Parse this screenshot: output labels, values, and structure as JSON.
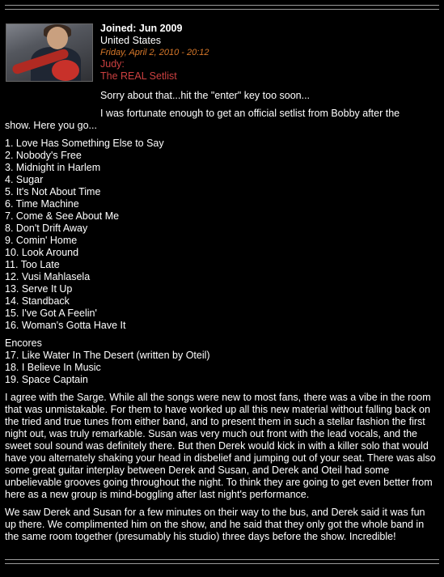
{
  "user": {
    "joined": "Joined: Jun 2009",
    "location": "United States",
    "avatar_icon": "user-avatar-photo"
  },
  "post": {
    "date": "Friday, April 2, 2010 - 20:12",
    "author": "Judy",
    "subject": "The REAL Setlist",
    "sorry": "Sorry about that...hit the \"enter\" key too soon...",
    "intro_line1": "I was fortunate enough to get an official setlist from Bobby after the",
    "intro_line2": "show. Here you go...",
    "setlist": [
      "1. Love Has Something Else to Say",
      "2. Nobody's Free",
      "3. Midnight in Harlem",
      "4. Sugar",
      "5. It's Not About Time",
      "6. Time Machine",
      "7. Come & See About Me",
      "8. Don't Drift Away",
      "9. Comin' Home",
      "10. Look Around",
      "11. Too Late",
      "12. Vusi Mahlasela",
      "13. Serve It Up",
      "14. Standback",
      "15. I've Got A Feelin'",
      "16. Woman's Gotta Have It"
    ],
    "encores_label": "Encores",
    "encores": [
      "17. Like Water In The Desert (written by Oteil)",
      "18. I Believe In Music",
      "19. Space Captain"
    ],
    "paragraph1": "I agree with the Sarge. While all the songs were new to most fans, there was a vibe in the room that was unmistakable. For them to have worked up all this new material without falling back on the tried and true tunes from either band, and to present them in such a stellar fashion the first night out, was truly remarkable. Susan was very much out front with the lead vocals, and the sweet soul sound was definitely there. But then Derek would kick in with a killer solo that would have you alternately shaking your head in disbelief and jumping out of your seat. There was also some great guitar interplay between Derek and Susan, and Derek and Oteil had some unbelievable grooves going throughout the night. To think they are going to get even better from here as a new group is mind-boggling after last night's performance.",
    "paragraph2": "We saw Derek and Susan for a few minutes on their way to the bus, and Derek said it was fun up there. We complimented him on the show, and he said that they only got the whole band in the same room together (presumably his studio) three days before the show. Incredible!"
  },
  "colors": {
    "background": "#000000",
    "text": "#ffffff",
    "date": "#d9792a",
    "link": "#cc4040",
    "rule": "#9a9a9a"
  }
}
